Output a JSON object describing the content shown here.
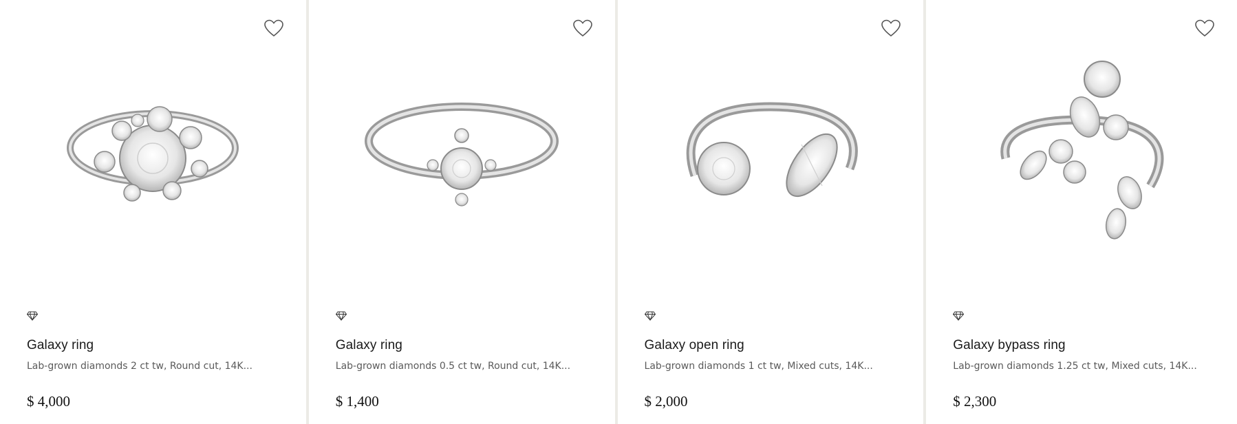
{
  "products": [
    {
      "name": "Galaxy ring",
      "description": "Lab-grown diamonds 2 ct tw, Round cut, 14K...",
      "price": "$ 4,000",
      "image": "cluster-diamond-ring",
      "badge_icon": "diamond-icon",
      "favorite_icon": "heart-outline-icon"
    },
    {
      "name": "Galaxy ring",
      "description": "Lab-grown diamonds 0.5 ct tw, Round cut, 14K...",
      "price": "$ 1,400",
      "image": "solitaire-diamond-ring",
      "badge_icon": "diamond-icon",
      "favorite_icon": "heart-outline-icon"
    },
    {
      "name": "Galaxy open ring",
      "description": "Lab-grown diamonds 1 ct tw, Mixed cuts, 14K...",
      "price": "$ 2,000",
      "image": "open-toi-et-moi-ring",
      "badge_icon": "diamond-icon",
      "favorite_icon": "heart-outline-icon"
    },
    {
      "name": "Galaxy bypass ring",
      "description": "Lab-grown diamonds 1.25 ct tw, Mixed cuts, 14K...",
      "price": "$ 2,300",
      "image": "bypass-diamond-ring",
      "badge_icon": "diamond-icon",
      "favorite_icon": "heart-outline-icon"
    }
  ],
  "colors": {
    "divider": "#ecebe6",
    "text": "#1a1a1a",
    "muted": "#5a5a5a",
    "metal": "#bcbcbc"
  }
}
